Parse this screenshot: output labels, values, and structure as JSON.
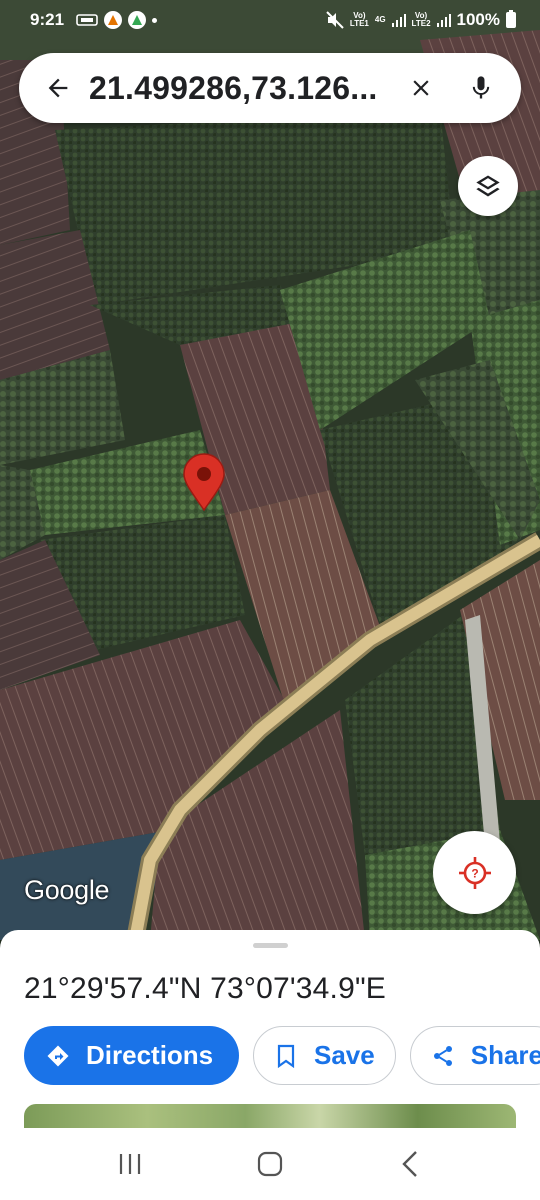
{
  "status_bar": {
    "time": "9:21",
    "net1_top": "Vo)",
    "net1_mid": "4G",
    "net1_bottom": "LTE1",
    "net2_top": "Vo)",
    "net2_bottom": "LTE2",
    "battery": "100%"
  },
  "search": {
    "query": "21.499286,73.126..."
  },
  "map": {
    "attribution": "Google"
  },
  "place": {
    "coordinates": "21°29'57.4\"N 73°07'34.9\"E"
  },
  "actions": {
    "directions_label": "Directions",
    "save_label": "Save",
    "share_label": "Share"
  },
  "colors": {
    "accent": "#1a73e8",
    "pin": "#d93025",
    "road": "#d9c38e"
  },
  "icons": {
    "back": "arrow-left-icon",
    "clear": "close-icon",
    "mic": "mic-icon",
    "layers": "layers-icon",
    "location": "my-location-icon",
    "directions": "directions-icon",
    "save": "bookmark-icon",
    "share": "share-icon"
  }
}
